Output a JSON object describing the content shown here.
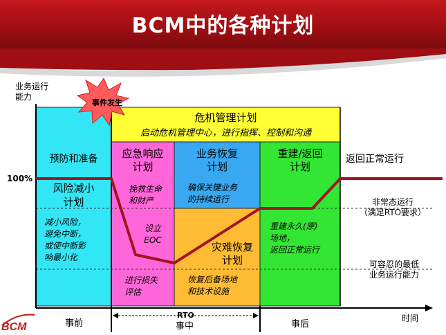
{
  "title": "BCM中的各种计划",
  "y_axis_label": "业务运行\n能力",
  "event_label": "事件发生",
  "level_100": "100%",
  "crisis_plan": {
    "title": "危机管理计划",
    "subtitle": "启动危机管理中心，进行指挥、控制和沟通"
  },
  "columns": {
    "prevention": {
      "header": "预防和准备",
      "plan": "风险减小\n计划",
      "desc": "减小风险，\n避免中断，\n或使中断影\n响最小化"
    },
    "emergency": {
      "header": "应急响应\n计划",
      "desc1": "挽救生命\n和财产",
      "desc2": "设立\nEOC",
      "desc3": "进行损失\n评估"
    },
    "business": {
      "header": "业务恢复\n计划",
      "desc1": "确保关键业务\n的持续运行",
      "disaster": "灾难恢复\n计划",
      "desc2": "恢复后备场地\n和技术设施"
    },
    "rebuild": {
      "header": "重建/返回\n计划",
      "desc": "重建永久(原)\n场地，\n返回正常运行"
    },
    "normal": {
      "header": "返回正常运行"
    }
  },
  "right_labels": {
    "abnormal": "非常态运行\n（满足RTO要求）",
    "tolerable": "可容忍的最低\n业务运行能力"
  },
  "phases": {
    "before": "事前",
    "rto": "RTO",
    "during": "事中",
    "after": "事后"
  },
  "x_axis_label": "时间",
  "logo": "BCM",
  "colors": {
    "header_red": "#b3141a",
    "cyan": "#33e6f5",
    "pink": "#ff66d9",
    "blue": "#38a8f0",
    "green": "#33e633",
    "yellow": "#ffff33",
    "orange": "#ffbb33",
    "curve": "#a01520"
  }
}
